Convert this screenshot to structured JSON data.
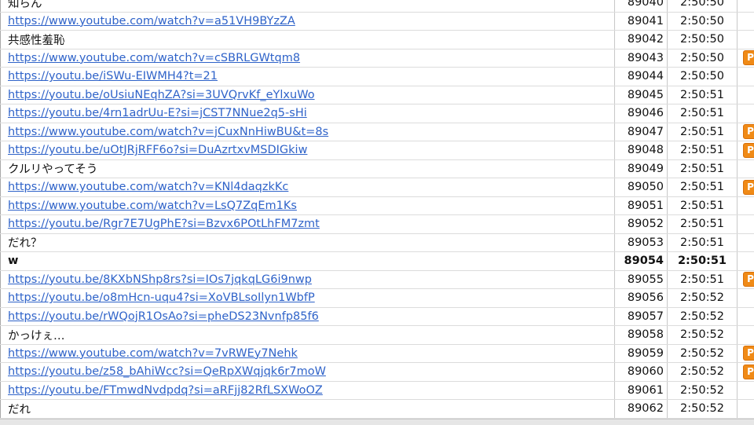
{
  "badge_label": "P",
  "colors": {
    "link": "#2f63c9",
    "badge": "#f08a16"
  },
  "rows": [
    {
      "text": "知らん",
      "type": "text",
      "no": "89040",
      "time": "2:50:50",
      "badge": false,
      "bold": false
    },
    {
      "text": "https://www.youtube.com/watch?v=a51VH9BYzZA",
      "type": "link",
      "no": "89041",
      "time": "2:50:50",
      "badge": false,
      "bold": false
    },
    {
      "text": "共感性羞恥",
      "type": "text",
      "no": "89042",
      "time": "2:50:50",
      "badge": false,
      "bold": false
    },
    {
      "text": "https://www.youtube.com/watch?v=cSBRLGWtqm8",
      "type": "link",
      "no": "89043",
      "time": "2:50:50",
      "badge": true,
      "bold": false
    },
    {
      "text": "https://youtu.be/iSWu-EIWMH4?t=21",
      "type": "link",
      "no": "89044",
      "time": "2:50:50",
      "badge": false,
      "bold": false
    },
    {
      "text": "https://youtu.be/oUsiuNEqhZA?si=3UVQrvKf_eYlxuWo",
      "type": "link",
      "no": "89045",
      "time": "2:50:51",
      "badge": false,
      "bold": false
    },
    {
      "text": "https://youtu.be/4rn1adrUu-E?si=jCST7NNue2q5-sHi",
      "type": "link",
      "no": "89046",
      "time": "2:50:51",
      "badge": false,
      "bold": false
    },
    {
      "text": "https://www.youtube.com/watch?v=jCuxNnHiwBU&t=8s",
      "type": "link",
      "no": "89047",
      "time": "2:50:51",
      "badge": true,
      "bold": false
    },
    {
      "text": "https://youtu.be/uOtJRjRFF6o?si=DuAzrtxvMSDIGkiw",
      "type": "link",
      "no": "89048",
      "time": "2:50:51",
      "badge": true,
      "bold": false
    },
    {
      "text": "クルリやってそう",
      "type": "text",
      "no": "89049",
      "time": "2:50:51",
      "badge": false,
      "bold": false
    },
    {
      "text": "https://www.youtube.com/watch?v=KNl4daqzkKc",
      "type": "link",
      "no": "89050",
      "time": "2:50:51",
      "badge": true,
      "bold": false
    },
    {
      "text": "https://www.youtube.com/watch?v=LsQ7ZqEm1Ks",
      "type": "link",
      "no": "89051",
      "time": "2:50:51",
      "badge": false,
      "bold": false
    },
    {
      "text": "https://youtu.be/Rgr7E7UgPhE?si=Bzvx6POtLhFM7zmt",
      "type": "link",
      "no": "89052",
      "time": "2:50:51",
      "badge": false,
      "bold": false
    },
    {
      "text": "だれ？",
      "type": "text",
      "no": "89053",
      "time": "2:50:51",
      "badge": false,
      "bold": false
    },
    {
      "text": "w",
      "type": "text",
      "no": "89054",
      "time": "2:50:51",
      "badge": false,
      "bold": true
    },
    {
      "text": "https://youtu.be/8KXbNShp8rs?si=IOs7jqkqLG6i9nwp",
      "type": "link",
      "no": "89055",
      "time": "2:50:51",
      "badge": true,
      "bold": false
    },
    {
      "text": "https://youtu.be/o8mHcn-uqu4?si=XoVBLsoIlyn1WbfP",
      "type": "link",
      "no": "89056",
      "time": "2:50:52",
      "badge": false,
      "bold": false
    },
    {
      "text": "https://youtu.be/rWQojR1OsAo?si=pheDS23Nvnfp85f6",
      "type": "link",
      "no": "89057",
      "time": "2:50:52",
      "badge": false,
      "bold": false
    },
    {
      "text": "かっけぇ…",
      "type": "text",
      "no": "89058",
      "time": "2:50:52",
      "badge": false,
      "bold": false
    },
    {
      "text": "https://www.youtube.com/watch?v=7vRWEy7Nehk",
      "type": "link",
      "no": "89059",
      "time": "2:50:52",
      "badge": true,
      "bold": false
    },
    {
      "text": "https://youtu.be/z58_bAhiWcc?si=QeRpXWqjqk6r7moW",
      "type": "link",
      "no": "89060",
      "time": "2:50:52",
      "badge": true,
      "bold": false
    },
    {
      "text": "https://youtu.be/FTmwdNvdpdq?si=aRFjj82RfLSXWoOZ",
      "type": "link",
      "no": "89061",
      "time": "2:50:52",
      "badge": false,
      "bold": false
    },
    {
      "text": "だれ",
      "type": "text",
      "no": "89062",
      "time": "2:50:52",
      "badge": false,
      "bold": false
    }
  ]
}
